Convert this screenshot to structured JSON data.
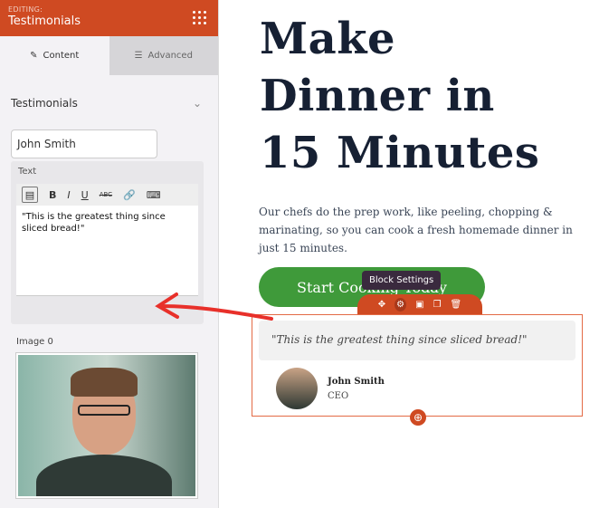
{
  "sidebar": {
    "editing_label": "EDITING:",
    "title": "Testimonials",
    "tabs": [
      {
        "label": "Content",
        "icon": "pencil-icon"
      },
      {
        "label": "Advanced",
        "icon": "sliders-icon"
      }
    ],
    "section_title": "Testimonials",
    "name_value": "John Smith",
    "text_label": "Text",
    "toolbar": [
      "paste",
      "B",
      "I",
      "U",
      "ABC",
      "link",
      "keyboard"
    ],
    "text_value": "\"This is the greatest thing since sliced bread!\"",
    "image_label": "Image 0"
  },
  "main": {
    "headline": "Make Dinner in 15 Minutes",
    "description": "Our chefs do the prep work, like peeling, chopping & marinating, so you can cook a fresh homemade dinner in just 15 minutes.",
    "cta_label": "Start Cooking Today",
    "tooltip": "Block Settings",
    "testimonial": {
      "quote": "\"This is the greatest thing since sliced bread!\"",
      "name": "John Smith",
      "role": "CEO"
    }
  },
  "colors": {
    "accent": "#cf4a22",
    "cta": "#3f9a3a",
    "heading": "#162033",
    "arrow": "#e8302a"
  }
}
